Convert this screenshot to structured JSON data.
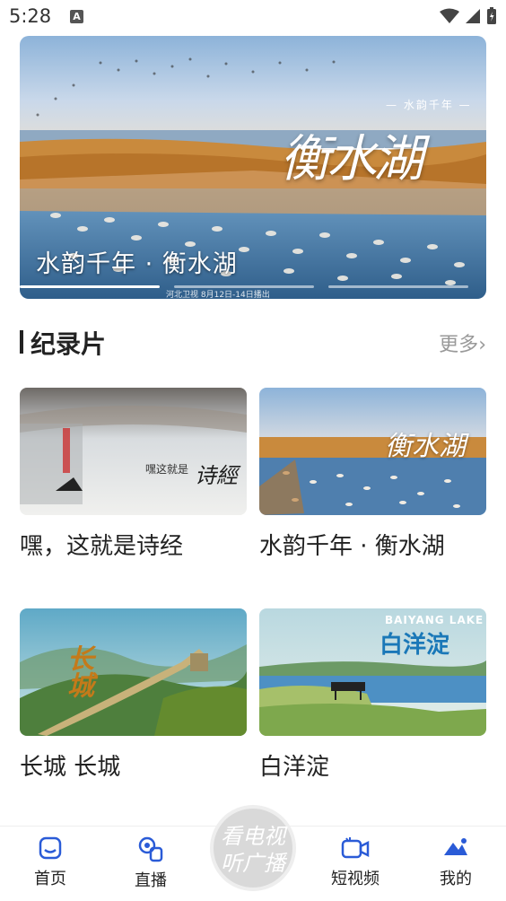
{
  "status_bar": {
    "time": "5:28",
    "notification_glyph": "A"
  },
  "banner": {
    "title": "水韵千年 · 衡水湖",
    "calligraphy": "衡水湖",
    "subtitle": "— 水韵千年 —",
    "caption": "河北卫视  8月12日-14日播出",
    "slide_count": 3,
    "active_slide": 1
  },
  "section": {
    "title": "纪录片",
    "more_label": "更多"
  },
  "cards": [
    {
      "title": "嘿，这就是诗经"
    },
    {
      "title": "水韵千年 · 衡水湖"
    },
    {
      "title": "长城  长城"
    },
    {
      "title": "白洋淀"
    }
  ],
  "card_art": {
    "shijing": "诗經",
    "shijing_prefix": "嘿这就是",
    "hengshui": "衡水湖",
    "changcheng": "长城",
    "baiyang_en": "BAIYANG LAKE",
    "baiyang_cn": "白洋淀"
  },
  "bottom_nav": {
    "items": [
      {
        "label": "首页",
        "icon": "home-icon"
      },
      {
        "label": "直播",
        "icon": "live-icon"
      },
      {
        "label": "短视频",
        "icon": "short-video-icon"
      },
      {
        "label": "我的",
        "icon": "profile-icon"
      }
    ],
    "center_label_line1": "看电视",
    "center_label_line2": "听广播"
  },
  "colors": {
    "accent_blue": "#2a5bd7",
    "text_dark": "#222222",
    "more_gray": "#999999"
  }
}
